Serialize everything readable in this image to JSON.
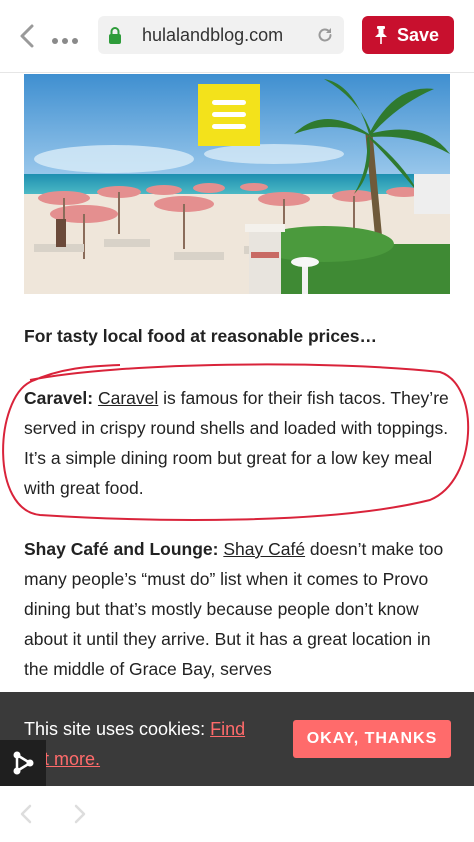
{
  "browser": {
    "url": "hulalandblog.com",
    "save_label": "Save"
  },
  "article": {
    "heading": "For tasty local food at reasonable prices…",
    "caravel": {
      "label": "Caravel:",
      "link": "Caravel",
      "text": " is famous for their fish tacos. They’re served in crispy round shells and loaded with toppings. It’s a simple dining room but great for a low key meal with great food."
    },
    "shay": {
      "label": "Shay Café and Lounge:",
      "link": "Shay Café",
      "text": " doesn’t make too many people’s “must do” list when it comes to Provo dining but that’s mostly because people don’t know about it until they arrive. But it has a great location in the middle of Grace Bay, serves"
    }
  },
  "cookie_banner": {
    "text": "This site uses cookies: ",
    "link": "Find out more.",
    "button": "OKAY, THANKS"
  },
  "colors": {
    "save_red": "#c8102e",
    "menu_yellow": "#f3e21b",
    "annotation_red": "#d9233a",
    "cookie_bg": "#3a3a3a",
    "cookie_accent": "#ff6b6b"
  },
  "icons": [
    "back-arrow-icon",
    "more-dots-icon",
    "lock-icon",
    "reload-icon",
    "pin-icon",
    "hamburger-menu-icon",
    "share-icon",
    "nav-back-icon",
    "nav-forward-icon"
  ]
}
